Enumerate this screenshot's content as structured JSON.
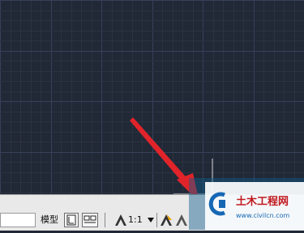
{
  "statusbar": {
    "model_tab_label": "模型",
    "annotation_scale": "1:1"
  },
  "watermark": {
    "site_name": "土木工程网",
    "site_url": "www.civilcn.com"
  },
  "colors": {
    "canvas_bg": "#212836",
    "grid_minor": "#2b3342",
    "grid_major": "#36405a",
    "arrow": "#e0242a",
    "watermark_bg": "#0d5a8c"
  },
  "icons": [
    "layout-view-icon",
    "quick-view-icon",
    "annotation-scale-icon",
    "annotation-visibility-icon",
    "auto-scale-icon"
  ]
}
